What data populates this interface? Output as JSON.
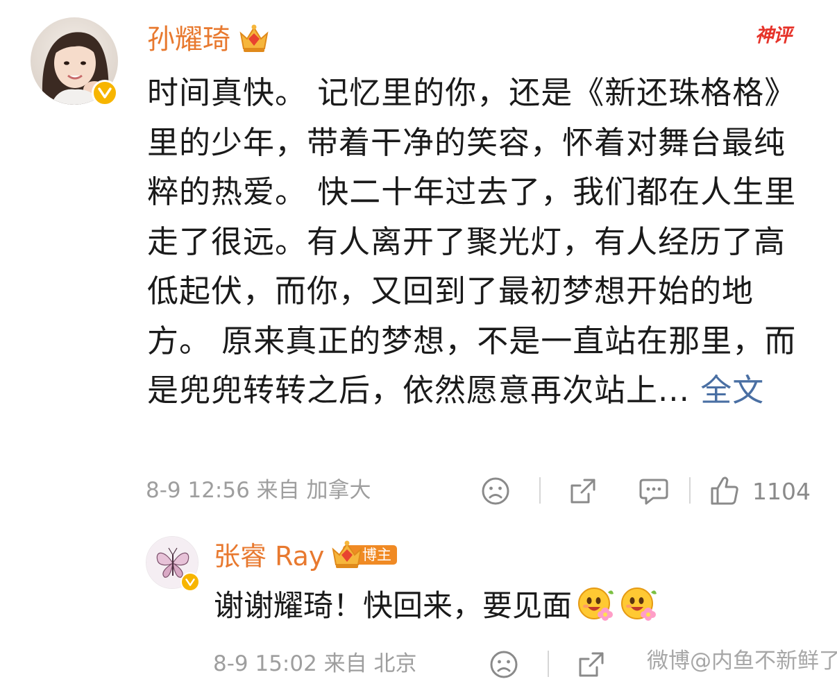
{
  "comment": {
    "author_name": "孙耀琦",
    "hot_tag": "神评",
    "text": "时间真快。  记忆里的你，还是《新还珠格格》里的少年，带着干净的笑容，怀着对舞台最纯粹的热爱。  快二十年过去了，我们都在人生里走了很远。有人离开了聚光灯，有人经历了高低起伏，而你，又回到了最初梦想开始的地方。  原来真正的梦想，不是一直站在那里，而是兜兜转转之后，依然愿意再次站上...",
    "full_text_link": "全文",
    "meta": "8-9 12:56 来自 加拿大",
    "like_count": "1104"
  },
  "reply": {
    "author_name": "张睿 Ray",
    "host_badge": "博主",
    "text": "谢谢耀琦！快回来，要见面",
    "emojis": [
      "happy-flower-emoji",
      "happy-flower-emoji"
    ],
    "meta": "8-9 15:02 来自 北京"
  },
  "watermark": "微博@内鱼不新鲜了",
  "icons": {
    "dislike": "sad-face-icon",
    "share": "share-icon",
    "comment": "comment-bubble-icon",
    "like": "thumbs-up-icon",
    "verified": "verified-v-icon",
    "crown": "crown-icon"
  },
  "colors": {
    "username": "#e8792f",
    "hot_tag": "#e6332a",
    "link": "#4a6fa3",
    "meta": "#9e9e9e",
    "verified": "#f7b500",
    "host_badge": "#f08a24"
  }
}
